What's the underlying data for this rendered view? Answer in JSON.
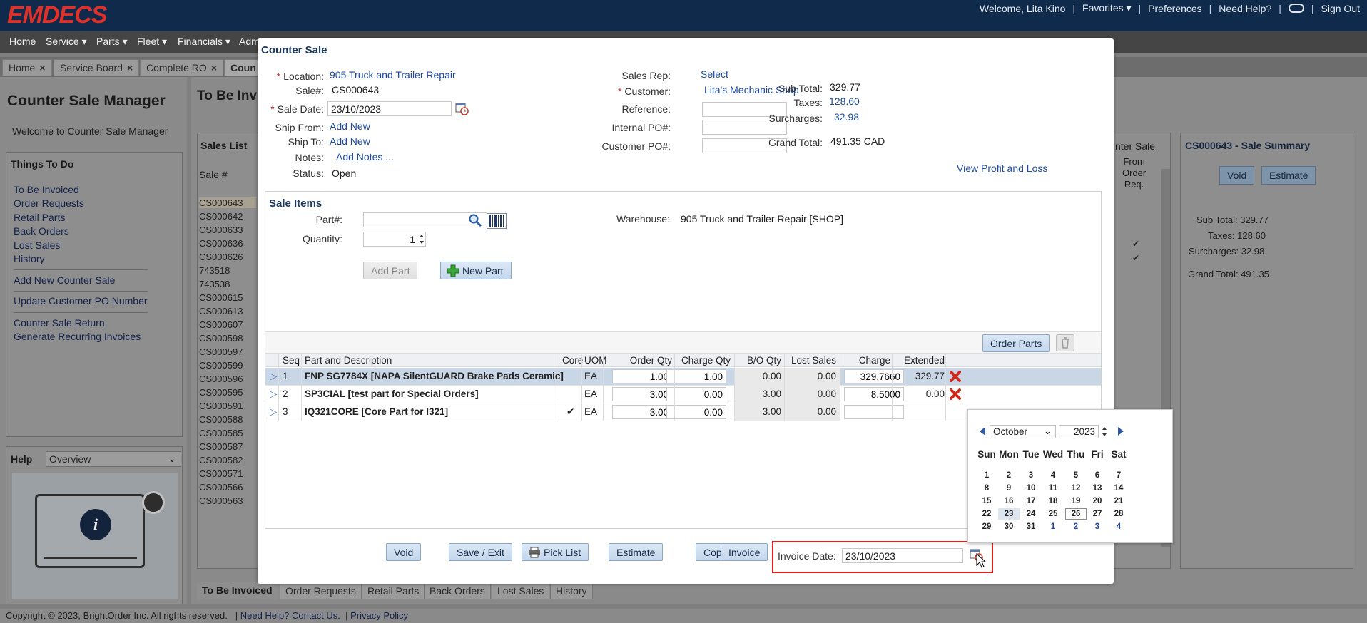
{
  "header": {
    "logo": "EMDECS",
    "welcome": "Welcome, Lita Kino",
    "favorites": "Favorites",
    "preferences": "Preferences",
    "need_help": "Need Help?",
    "sign_out": "Sign Out"
  },
  "menu": [
    "Home",
    "Service",
    "Parts",
    "Fleet",
    "Financials",
    "Adm"
  ],
  "tabs": [
    "Home",
    "Service Board",
    "Complete RO",
    "Coun"
  ],
  "left_panel": {
    "title": "Counter Sale Manager",
    "welcome": "Welcome to Counter Sale Manager",
    "things_to_do": "Things To Do",
    "links_group1": [
      "To Be Invoiced",
      "Order Requests",
      "Retail Parts",
      "Back Orders",
      "Lost Sales",
      "History"
    ],
    "links_group2": [
      "Add New Counter Sale",
      "Update Customer PO Number"
    ],
    "links_group3": [
      "Counter Sale Return",
      "Generate Recurring Invoices"
    ],
    "help_label": "Help",
    "help_select": "Overview"
  },
  "main": {
    "title": "To Be Invoi",
    "sales_list_title": "Sales List",
    "col_sale_no": "Sale #",
    "rows": [
      "CS000643",
      "CS000642",
      "CS000633",
      "CS000636",
      "CS000626",
      "743518",
      "743538",
      "CS000615",
      "CS000613",
      "CS000607",
      "CS000598",
      "CS000597",
      "CS000599",
      "CS000596",
      "CS000595",
      "CS000591",
      "CS000588",
      "CS000585",
      "CS000587",
      "CS000582",
      "CS000571",
      "CS000566",
      "CS000563"
    ],
    "right_col_header": "nter Sale",
    "from_order_req": [
      "From",
      "Order",
      "Req."
    ]
  },
  "summary": {
    "title": "CS000643 - Sale Summary",
    "void": "Void",
    "estimate": "Estimate",
    "sub_total": "Sub Total: 329.77",
    "taxes": "Taxes: 128.60",
    "surcharges": "Surcharges:  32.98",
    "grand_total": "Grand Total: 491.35"
  },
  "bottom_tabs": [
    "To Be Invoiced",
    "Order Requests",
    "Retail Parts",
    "Back Orders",
    "Lost Sales",
    "History"
  ],
  "footer": {
    "copyright": "Copyright © 2023, BrightOrder Inc. All rights reserved.",
    "contact": "Need Help? Contact Us.",
    "privacy": "Privacy Policy"
  },
  "modal": {
    "title": "Counter Sale",
    "location_label": "Location:",
    "location": "905 Truck and Trailer Repair",
    "sale_no_label": "Sale#:",
    "sale_no": "CS000643",
    "sale_date_label": "Sale Date:",
    "sale_date": "23/10/2023",
    "ship_from_label": "Ship From:",
    "ship_from": "Add New",
    "ship_to_label": "Ship To:",
    "ship_to": "Add New",
    "notes_label": "Notes:",
    "notes": "Add Notes ...",
    "status_label": "Status:",
    "status": "Open",
    "sales_rep_label": "Sales Rep:",
    "sales_rep": "Select",
    "customer_label": "Customer:",
    "customer": "Lita's Mechanic Shop",
    "reference_label": "Reference:",
    "internal_po_label": "Internal PO#:",
    "customer_po_label": "Customer PO#:",
    "sub_total_label": "Sub Total:",
    "sub_total": "329.77",
    "taxes_label": "Taxes:",
    "taxes": "128.60",
    "surcharges_label": "Surcharges:",
    "surcharges": "32.98",
    "grand_total_label": "Grand Total:",
    "grand_total": "491.35  CAD",
    "profit_loss": "View Profit and Loss"
  },
  "sale_items": {
    "title": "Sale Items",
    "part_label": "Part#:",
    "quantity_label": "Quantity:",
    "quantity": "1",
    "warehouse_label": "Warehouse:",
    "warehouse": "905 Truck and Trailer Repair [SHOP]",
    "add_part": "Add Part",
    "new_part": "New Part",
    "order_parts": "Order Parts",
    "columns": [
      "Seq",
      "Part and Description",
      "Core",
      "UOM",
      "Order Qty",
      "Charge Qty",
      "B/O Qty",
      "Lost Sales",
      "Charge",
      "Extended"
    ],
    "rows": [
      {
        "seq": "1",
        "part": "FNP SG7784X [NAPA SilentGUARD Brake Pads Ceramic]",
        "core": "",
        "uom": "EA",
        "order_qty": "1.00",
        "charge_qty": "1.00",
        "bo_qty": "0.00",
        "lost": "0.00",
        "charge": "329.7660",
        "extended": "329.77"
      },
      {
        "seq": "2",
        "part": "SP3CIAL [test part for Special Orders]",
        "core": "",
        "uom": "EA",
        "order_qty": "3.00",
        "charge_qty": "0.00",
        "bo_qty": "3.00",
        "lost": "0.00",
        "charge": "8.5000",
        "extended": "0.00"
      },
      {
        "seq": "3",
        "part": "IQ321CORE [Core Part for I321]",
        "core": "✔",
        "uom": "EA",
        "order_qty": "3.00",
        "charge_qty": "0.00",
        "bo_qty": "3.00",
        "lost": "0.00",
        "charge": "",
        "extended": ""
      }
    ]
  },
  "actions": {
    "void": "Void",
    "save_exit": "Save / Exit",
    "pick_list": "Pick List",
    "estimate": "Estimate",
    "copy": "Copy",
    "invoice": "Invoice",
    "invoice_date_label": "Invoice Date:",
    "invoice_date": "23/10/2023"
  },
  "datepicker": {
    "month": "October",
    "year": "2023",
    "dow": [
      "Sun",
      "Mon",
      "Tue",
      "Wed",
      "Thu",
      "Fri",
      "Sat"
    ],
    "weeks": [
      [
        "1",
        "2",
        "3",
        "4",
        "5",
        "6",
        "7"
      ],
      [
        "8",
        "9",
        "10",
        "11",
        "12",
        "13",
        "14"
      ],
      [
        "15",
        "16",
        "17",
        "18",
        "19",
        "20",
        "21"
      ],
      [
        "22",
        "23",
        "24",
        "25",
        "26",
        "27",
        "28"
      ],
      [
        "29",
        "30",
        "31",
        "1",
        "2",
        "3",
        "4"
      ]
    ]
  },
  "colors": {
    "header_bg": "#0f2a4a",
    "logo": "#e0302a",
    "link": "#1f4aa0",
    "highlight_box": "#e01f1f"
  }
}
